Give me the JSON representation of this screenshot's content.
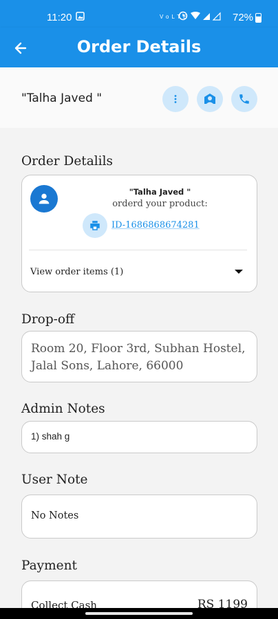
{
  "status_bar": {
    "time": "11:20",
    "battery": "72%"
  },
  "app_bar": {
    "title": "Order Details"
  },
  "customer": {
    "name": "\"Talha Javed \""
  },
  "order_details": {
    "section_title": "Order Detalils",
    "customer_name": "\"Talha Javed \"",
    "subtitle": "orderd your product:",
    "order_id": "ID-1686868674281",
    "view_items_label": "View order items (1)"
  },
  "dropoff": {
    "section_title": "Drop-off",
    "address": "Room 20, Floor 3rd, Subhan Hostel, Jalal Sons, Lahore, 66000"
  },
  "admin_notes": {
    "section_title": "Admin Notes",
    "note": "1)  shah g"
  },
  "user_note": {
    "section_title": "User Note",
    "note": "No Notes"
  },
  "payment": {
    "section_title": "Payment",
    "method": "Collect Cash",
    "amount": "RS 1199"
  },
  "colors": {
    "primary": "#1a90e8",
    "light_accent": "#cfe8fb"
  },
  "icons": [
    "back-arrow-icon",
    "more-vert-icon",
    "location-icon",
    "phone-icon",
    "person-icon",
    "print-icon",
    "dropdown-icon"
  ]
}
